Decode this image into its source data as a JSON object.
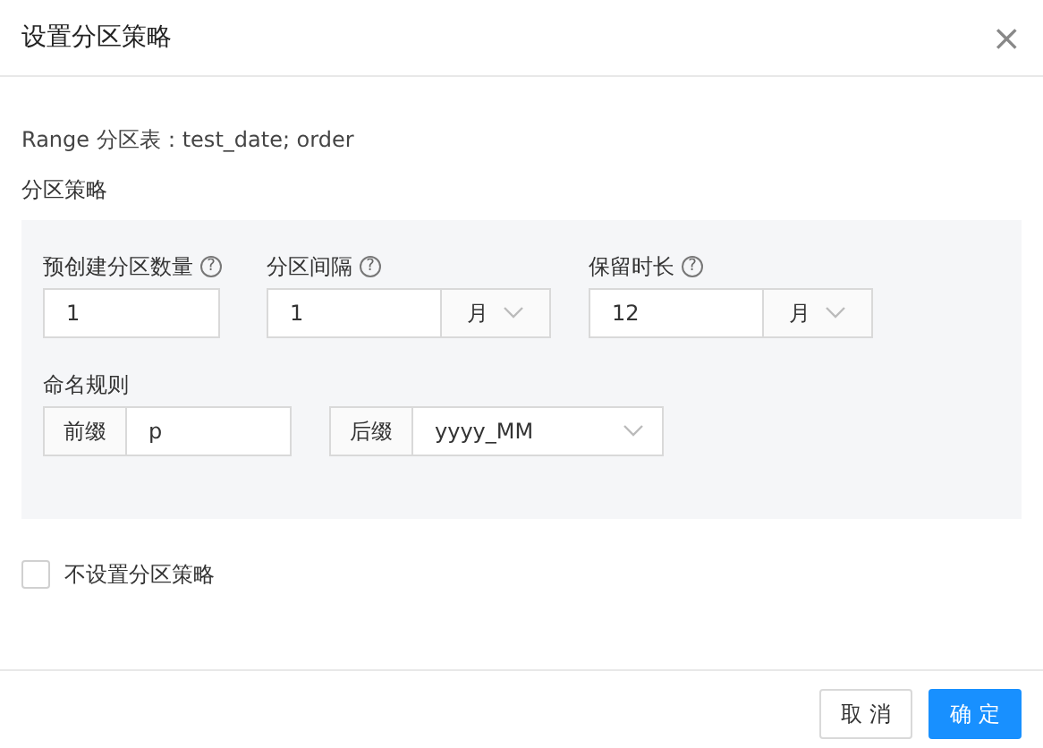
{
  "dialog": {
    "title": "设置分区策略",
    "close": "×"
  },
  "table_info": "Range 分区表：test_date; order",
  "section_label": "分区策略",
  "fields": [
    {
      "kind": "number",
      "label": "预创建分区数量",
      "help": "?",
      "value": "1"
    },
    {
      "kind": "number_unit",
      "label": "分区间隔",
      "help": "?",
      "value": "1",
      "unit": "月"
    },
    {
      "kind": "number_unit",
      "label": "保留时长",
      "help": "?",
      "value": "12",
      "unit": "月"
    }
  ],
  "naming": {
    "label": "命名规则",
    "prefix": {
      "addon": "前缀",
      "value": "p"
    },
    "suffix": {
      "addon": "后缀",
      "value": "yyyy_MM"
    }
  },
  "no_strategy": {
    "label": "不设置分区策略",
    "checked": false
  },
  "buttons": [
    {
      "label": "取 消",
      "kind": "default"
    },
    {
      "label": "确 定",
      "kind": "primary"
    }
  ]
}
